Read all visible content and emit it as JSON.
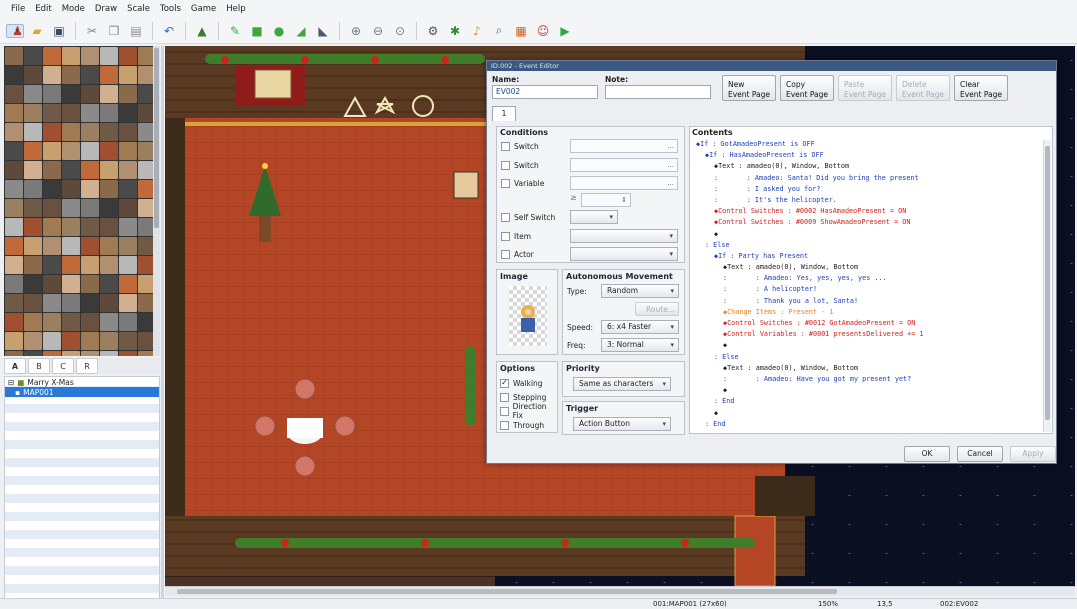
{
  "menu": [
    "File",
    "Edit",
    "Mode",
    "Draw",
    "Scale",
    "Tools",
    "Game",
    "Help"
  ],
  "toolbar_icons": [
    "new-project-icon",
    "open-project-icon",
    "save-project-icon",
    "cut-icon",
    "copy-icon",
    "paste-icon",
    "undo-icon",
    "map-mode-icon",
    "event-mode-icon",
    "pencil-icon",
    "rectangle-icon",
    "ellipse-icon",
    "flood-fill-icon",
    "shadow-pen-icon",
    "zoom-in-icon",
    "zoom-out-icon",
    "actual-size-icon",
    "database-icon",
    "plugin-manager-icon",
    "sound-test-icon",
    "event-searcher-icon",
    "resource-manager-icon",
    "character-generator-icon",
    "playtest-icon"
  ],
  "tileset_tabs": [
    "A",
    "B",
    "C",
    "R"
  ],
  "map_tree": {
    "project": "Marry X-Mas",
    "map": "MAP001"
  },
  "status": {
    "map": "001:MAP001 (27x60)",
    "zoom": "150%",
    "coords": "13,5",
    "event": "002:EV002"
  },
  "dialog": {
    "title": "ID:002 - Event Editor",
    "name_label": "Name:",
    "name_value": "EV002",
    "note_label": "Note:",
    "note_value": "",
    "page_buttons": [
      {
        "line1": "New",
        "line2": "Event Page",
        "disabled": false
      },
      {
        "line1": "Copy",
        "line2": "Event Page",
        "disabled": false
      },
      {
        "line1": "Paste",
        "line2": "Event Page",
        "disabled": true
      },
      {
        "line1": "Delete",
        "line2": "Event Page",
        "disabled": true
      },
      {
        "line1": "Clear",
        "line2": "Event Page",
        "disabled": false
      }
    ],
    "page_tab": "1",
    "conditions": {
      "title": "Conditions",
      "rows": [
        "Switch",
        "Switch",
        "Variable",
        "Self Switch",
        "Item",
        "Actor"
      ],
      "gte": "≥",
      "ellipsis": "..."
    },
    "image": {
      "title": "Image"
    },
    "movement": {
      "title": "Autonomous Movement",
      "type_label": "Type:",
      "type_value": "Random",
      "route_label": "Route...",
      "speed_label": "Speed:",
      "speed_value": "6: x4 Faster",
      "freq_label": "Freq:",
      "freq_value": "3: Normal"
    },
    "options": {
      "title": "Options",
      "items": [
        {
          "label": "Walking",
          "checked": true
        },
        {
          "label": "Stepping",
          "checked": false
        },
        {
          "label": "Direction Fix",
          "checked": false
        },
        {
          "label": "Through",
          "checked": false
        }
      ]
    },
    "priority": {
      "title": "Priority",
      "value": "Same as characters"
    },
    "trigger": {
      "title": "Trigger",
      "value": "Action Button"
    },
    "contents_title": "Contents",
    "lines": [
      {
        "ind": 0,
        "text": "◆If : GotAmadeoPresent is OFF",
        "color": "#1f3fb3"
      },
      {
        "ind": 1,
        "text": "◆If : HasAmadeoPresent is OFF",
        "color": "#1f3fb3"
      },
      {
        "ind": 2,
        "text": "◆Text : amadeo(0), Window, Bottom",
        "color": "#222"
      },
      {
        "ind": 2,
        "text": ":       : Amadeo: Santa! Did you bring the present",
        "color": "#1f3fb3"
      },
      {
        "ind": 2,
        "text": ":       : I asked you for?",
        "color": "#1f3fb3"
      },
      {
        "ind": 2,
        "text": ":       : It's the helicopter.",
        "color": "#1f3fb3"
      },
      {
        "ind": 2,
        "text": "◆Control Switches : #0002 HasAmadeoPresent = ON",
        "color": "#d0201c"
      },
      {
        "ind": 2,
        "text": "◆Control Switches : #0009 ShowAmadeoPresent = ON",
        "color": "#d0201c"
      },
      {
        "ind": 2,
        "text": "◆",
        "color": "#222"
      },
      {
        "ind": 1,
        "text": ": Else",
        "color": "#1f3fb3"
      },
      {
        "ind": 2,
        "text": "◆If : Party has Present",
        "color": "#1f3fb3"
      },
      {
        "ind": 3,
        "text": "◆Text : amadeo(0), Window, Bottom",
        "color": "#222"
      },
      {
        "ind": 3,
        "text": ":       : Amadeo: Yes, yes, yes, yes ...",
        "color": "#1f3fb3"
      },
      {
        "ind": 3,
        "text": ":       : A helicopter!",
        "color": "#1f3fb3"
      },
      {
        "ind": 3,
        "text": ":       : Thank you a lot, Santa!",
        "color": "#1f3fb3"
      },
      {
        "ind": 3,
        "text": "◆Change Items : Present - 1",
        "color": "#e8831c"
      },
      {
        "ind": 3,
        "text": "◆Control Switches : #0012 GotAmadeoPresent = ON",
        "color": "#d0201c"
      },
      {
        "ind": 3,
        "text": "◆Control Variables : #0001 presentsDelivered += 1",
        "color": "#d0201c"
      },
      {
        "ind": 3,
        "text": "◆",
        "color": "#222"
      },
      {
        "ind": 2,
        "text": ": Else",
        "color": "#1f3fb3"
      },
      {
        "ind": 3,
        "text": "◆Text : amadeo(0), Window, Bottom",
        "color": "#222"
      },
      {
        "ind": 3,
        "text": ":       : Amadeo: Have you got my present yet?",
        "color": "#1f3fb3"
      },
      {
        "ind": 3,
        "text": "◆",
        "color": "#222"
      },
      {
        "ind": 2,
        "text": ": End",
        "color": "#1f3fb3"
      },
      {
        "ind": 2,
        "text": "◆",
        "color": "#222"
      },
      {
        "ind": 1,
        "text": ": End",
        "color": "#1f3fb3"
      }
    ],
    "ok": "OK",
    "cancel": "Cancel",
    "apply": "Apply"
  }
}
